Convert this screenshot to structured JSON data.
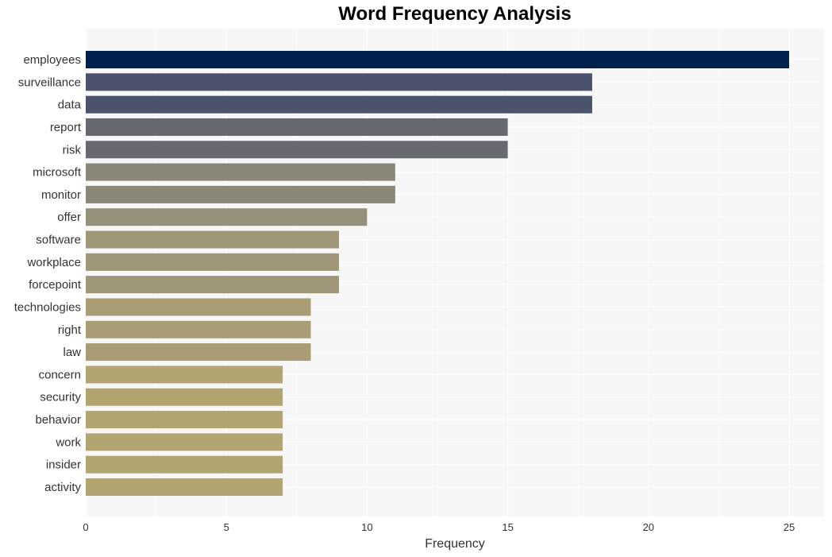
{
  "chart_data": {
    "type": "bar",
    "orientation": "horizontal",
    "title": "Word Frequency Analysis",
    "xlabel": "Frequency",
    "ylabel": "",
    "xlim": [
      0,
      26.25
    ],
    "xticks": [
      0,
      5,
      10,
      15,
      20,
      25
    ],
    "grid": true,
    "categories": [
      "employees",
      "surveillance",
      "data",
      "report",
      "risk",
      "microsoft",
      "monitor",
      "offer",
      "software",
      "workplace",
      "forcepoint",
      "technologies",
      "right",
      "law",
      "concern",
      "security",
      "behavior",
      "work",
      "insider",
      "activity"
    ],
    "values": [
      25,
      18,
      18,
      15,
      15,
      11,
      11,
      10,
      9,
      9,
      9,
      8,
      8,
      8,
      7,
      7,
      7,
      7,
      7,
      7
    ],
    "colors": [
      "#00204e",
      "#4a536b",
      "#4a536b",
      "#676970",
      "#676970",
      "#8a8779",
      "#8a8779",
      "#959079",
      "#9f9778",
      "#9f9778",
      "#9f9778",
      "#a99d75",
      "#a99d75",
      "#a99d75",
      "#b3a571",
      "#b3a571",
      "#b3a571",
      "#b3a571",
      "#b3a571",
      "#b3a571"
    ]
  }
}
